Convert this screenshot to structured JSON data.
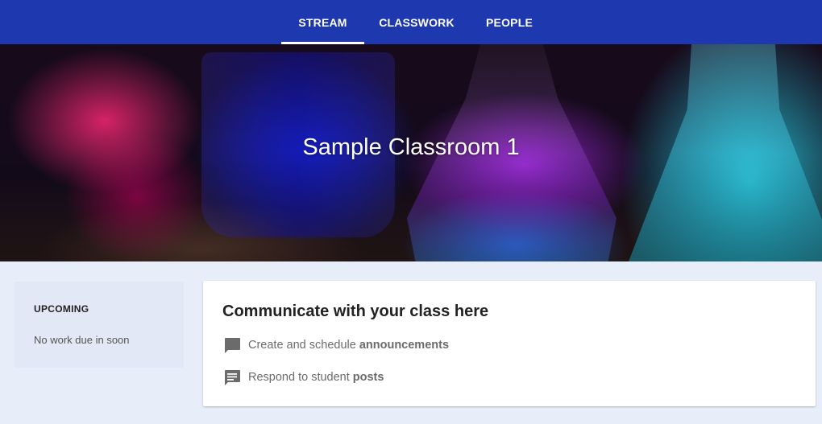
{
  "tabs": [
    {
      "label": "STREAM",
      "active": true
    },
    {
      "label": "CLASSWORK",
      "active": false
    },
    {
      "label": "PEOPLE",
      "active": false
    }
  ],
  "hero": {
    "title": "Sample Classroom",
    "section": "1"
  },
  "upcoming": {
    "title": "UPCOMING",
    "empty_text": "No work due in soon"
  },
  "intro_card": {
    "heading": "Communicate with your class here",
    "items": [
      {
        "icon": "comment-icon",
        "text": "Create and schedule",
        "bold": "announcements"
      },
      {
        "icon": "message-list-icon",
        "text": "Respond to student",
        "bold": "posts"
      }
    ]
  },
  "colors": {
    "topbar": "#1e39b0",
    "page_bg": "#e8eef9",
    "icon_gray": "#6b6b6b"
  }
}
